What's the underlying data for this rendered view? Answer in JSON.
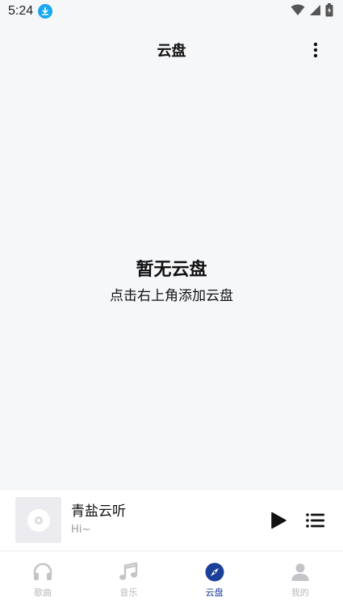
{
  "status_bar": {
    "time": "5:24"
  },
  "header": {
    "title": "云盘"
  },
  "empty_state": {
    "title": "暂无云盘",
    "subtitle": "点击右上角添加云盘"
  },
  "player": {
    "title": "青盐云听",
    "subtitle": "Hi~"
  },
  "bottom_nav": {
    "items": [
      {
        "label": "歌曲",
        "icon": "headphones-icon",
        "active": false
      },
      {
        "label": "音乐",
        "icon": "music-note-icon",
        "active": false
      },
      {
        "label": "云盘",
        "icon": "compass-icon",
        "active": true
      },
      {
        "label": "我的",
        "icon": "person-icon",
        "active": false
      }
    ]
  },
  "colors": {
    "background": "#f6f7f9",
    "accent": "#1c3f9a",
    "inactive": "#b9b9be",
    "download_badge": "#19a7f0"
  }
}
